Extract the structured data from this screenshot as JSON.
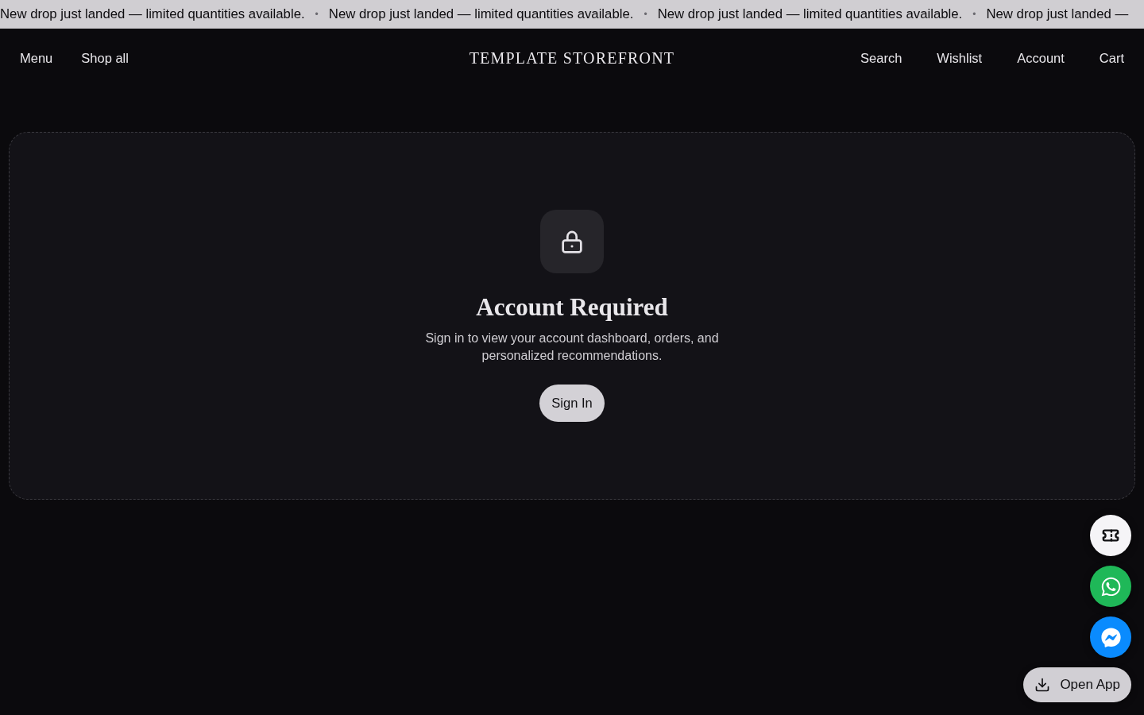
{
  "announcement_bar": {
    "segments": [
      {
        "kind": "text",
        "text": "New drop just landed — limited quantities available."
      },
      {
        "kind": "separator",
        "text": "•"
      },
      {
        "kind": "text",
        "text": "New drop just landed — limited quantities available."
      },
      {
        "kind": "separator",
        "text": "•"
      },
      {
        "kind": "text",
        "text": "New drop just landed — limited quantities available."
      },
      {
        "kind": "separator",
        "text": "•"
      },
      {
        "kind": "text",
        "text": "New drop just landed —"
      }
    ]
  },
  "header": {
    "left_links": [
      {
        "label": "Menu"
      },
      {
        "label": "Shop all"
      }
    ],
    "logo": "TEMPLATE STOREFRONT",
    "right_links": [
      {
        "label": "Search"
      },
      {
        "label": "Wishlist"
      },
      {
        "label": "Account"
      },
      {
        "label": "Cart"
      }
    ]
  },
  "account_gate": {
    "title": "Account Required",
    "message": "Sign in to view your account dashboard, orders, and personalized recommendations.",
    "button": "Sign In"
  },
  "floating_actions": [
    {
      "kind": "ticket",
      "color": "#f5f4f7"
    },
    {
      "kind": "chat",
      "color": "#1fb858"
    },
    {
      "kind": "messenger",
      "color": "#0a8bfe"
    }
  ],
  "open_app_button": {
    "label": "Open App"
  }
}
